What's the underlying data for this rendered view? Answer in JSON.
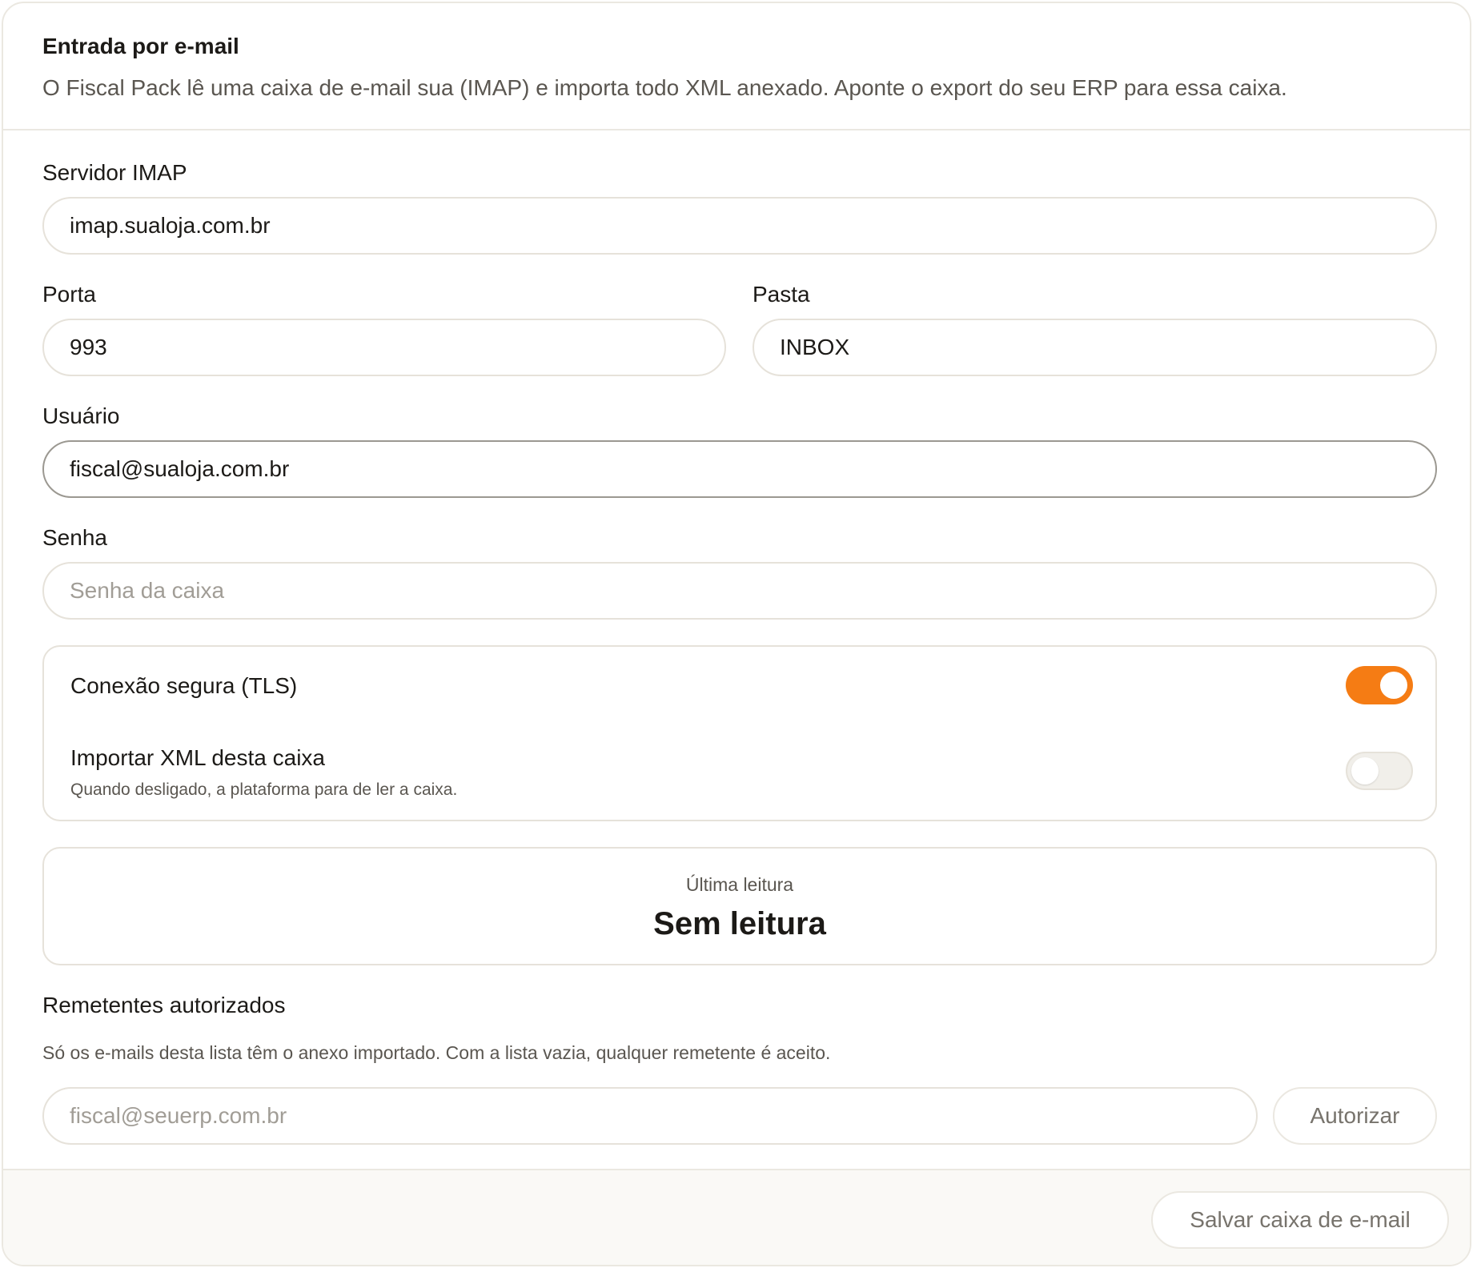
{
  "header": {
    "title": "Entrada por e-mail",
    "description": "O Fiscal Pack lê uma caixa de e-mail sua (IMAP) e importa todo XML anexado. Aponte o export do seu ERP para essa caixa."
  },
  "fields": {
    "server": {
      "label": "Servidor IMAP",
      "value": "imap.sualoja.com.br"
    },
    "port": {
      "label": "Porta",
      "value": "993"
    },
    "folder": {
      "label": "Pasta",
      "value": "INBOX"
    },
    "user": {
      "label": "Usuário",
      "value": "fiscal@sualoja.com.br"
    },
    "password": {
      "label": "Senha",
      "placeholder": "Senha da caixa"
    }
  },
  "toggles": {
    "tls": {
      "label": "Conexão segura (TLS)",
      "enabled": true
    },
    "import": {
      "label": "Importar XML desta caixa",
      "description": "Quando desligado, a plataforma para de ler a caixa.",
      "enabled": false
    }
  },
  "last_read": {
    "label": "Última leitura",
    "value": "Sem leitura"
  },
  "senders": {
    "title": "Remetentes autorizados",
    "description": "Só os e-mails desta lista têm o anexo importado. Com a lista vazia, qualquer remetente é aceito.",
    "placeholder": "fiscal@seuerp.com.br",
    "button": "Autorizar"
  },
  "footer": {
    "save_button": "Salvar caixa de e-mail"
  },
  "colors": {
    "accent": "#f57c14",
    "border": "#e6e2da",
    "muted_text": "#5a5650"
  }
}
